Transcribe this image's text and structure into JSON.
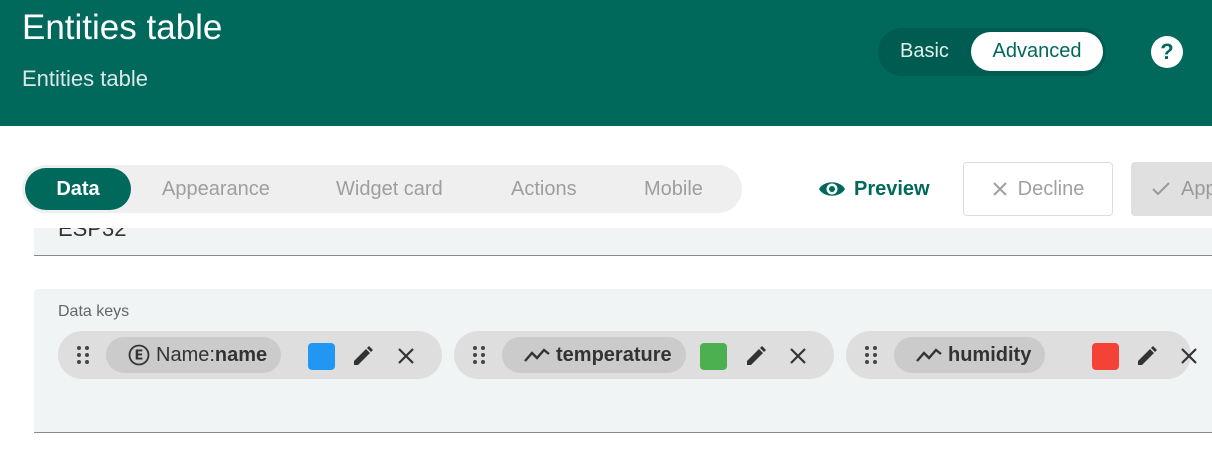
{
  "header": {
    "title": "Entities table",
    "subtitle": "Entities table",
    "mode_basic": "Basic",
    "mode_advanced": "Advanced",
    "help_icon": "?"
  },
  "tabs": [
    {
      "label": "Data",
      "active": true
    },
    {
      "label": "Appearance",
      "active": false
    },
    {
      "label": "Widget card",
      "active": false
    },
    {
      "label": "Actions",
      "active": false
    },
    {
      "label": "Mobile",
      "active": false
    }
  ],
  "actions": {
    "preview": "Preview",
    "decline": "Decline",
    "apply": "Apply"
  },
  "prev_field": {
    "value": "ESP32"
  },
  "data_keys": {
    "label": "Data keys",
    "keys": [
      {
        "type_icon": "entity-field-icon",
        "type_glyph": "E",
        "prefix": "Name: ",
        "name": "name",
        "color": "#2196f3"
      },
      {
        "type_icon": "timeseries-icon",
        "prefix": "",
        "name": "temperature",
        "color": "#4caf50"
      },
      {
        "type_icon": "timeseries-icon",
        "prefix": "",
        "name": "humidity",
        "color": "#f44336"
      }
    ]
  },
  "colors": {
    "primary": "#00695c"
  }
}
